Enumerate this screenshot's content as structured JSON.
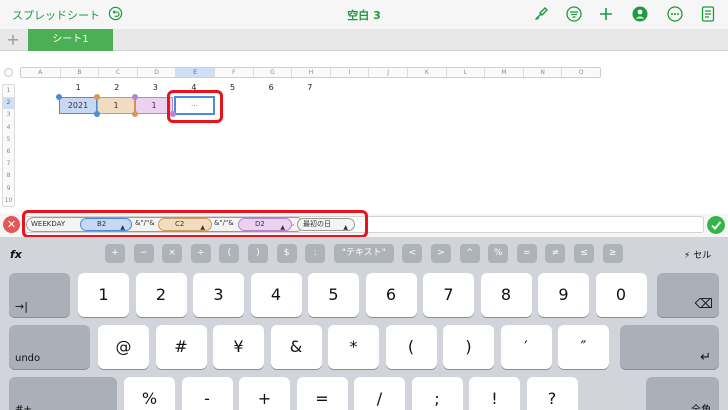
{
  "toolbar": {
    "back_label": "スプレッドシート",
    "title": "空白 3"
  },
  "tabs": {
    "add": "+",
    "sheet_name": "シート1"
  },
  "grid": {
    "columns": [
      "A",
      "B",
      "C",
      "D",
      "E",
      "F",
      "G",
      "H",
      "I",
      "J",
      "K",
      "L",
      "M",
      "N",
      "O"
    ],
    "active_column": "E",
    "rows": [
      "1",
      "2",
      "3",
      "4",
      "5",
      "6",
      "7",
      "8",
      "9",
      "10"
    ],
    "active_row": "2",
    "row1_values": [
      "1",
      "2",
      "3",
      "4",
      "5",
      "6",
      "7"
    ],
    "b2": "2021",
    "c2": "1",
    "d2": "1",
    "e2": "…"
  },
  "formula": {
    "function": "WEEKDAY",
    "ref1": "B2",
    "sep1": "&\"/\"&",
    "ref2": "C2",
    "sep2": "&\"/\"&",
    "ref3": "D2",
    "comma": ",",
    "arg": "最初の日",
    "arrow": "▲",
    "cancel": "✕"
  },
  "keyboard": {
    "fx": "fx",
    "symbols": [
      "+",
      "−",
      "×",
      "÷",
      "(",
      ")",
      "$",
      ":",
      "\"テキスト\"",
      "<",
      ">",
      "^",
      "%",
      "=",
      "≠",
      "≤",
      "≥"
    ],
    "cell": "セル",
    "row1": [
      "1",
      "2",
      "3",
      "4",
      "5",
      "6",
      "7",
      "8",
      "9",
      "0"
    ],
    "row2": [
      "@",
      "#",
      "¥",
      "&",
      "*",
      "(",
      ")",
      "′",
      "″"
    ],
    "row3": [
      "%",
      "-",
      "+",
      "=",
      "/",
      ";",
      "!",
      "?"
    ],
    "undo": "undo",
    "tab": "→|",
    "delete": "⌫",
    "return": "↵",
    "shift_left": "#+",
    "shift_right": "全角"
  },
  "colors": {
    "accent": "#1e9a3e",
    "selection": "#4e8ad8",
    "highlight": "#e8141c"
  }
}
